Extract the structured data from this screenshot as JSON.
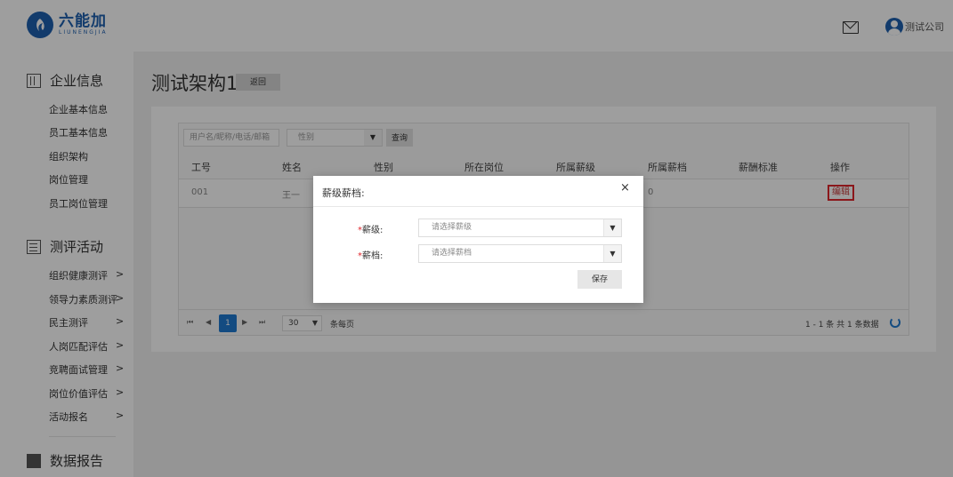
{
  "header": {
    "logo_text": "六能加",
    "logo_subtext": "LIUNENGJIA",
    "company": "测试公司"
  },
  "sidebar": {
    "sections": [
      {
        "title": "企业信息",
        "icon": "building-icon"
      },
      {
        "title": "测评活动",
        "icon": "list-icon"
      },
      {
        "title": "数据报告",
        "icon": "report-icon"
      }
    ],
    "enterprise_items": [
      "企业基本信息",
      "员工基本信息",
      "组织架构",
      "岗位管理",
      "员工岗位管理"
    ],
    "activity_items": [
      "组织健康测评",
      "领导力素质测评",
      "民主测评",
      "人岗匹配评估",
      "竞聘面试管理",
      "岗位价值评估",
      "活动报名"
    ],
    "arrow": ">"
  },
  "main": {
    "title": "测试架构1",
    "back_label": "返回",
    "search_placeholder": "用户名/昵称/电话/邮箱",
    "gender_placeholder": "性别",
    "query_label": "查询",
    "columns": [
      "工号",
      "姓名",
      "性别",
      "所在岗位",
      "所属薪级",
      "所属薪档",
      "薪酬标准",
      "操作"
    ],
    "rows": [
      {
        "id": "001",
        "name": "王一",
        "salary_grade": "0",
        "action": "编辑"
      }
    ],
    "pager": {
      "current_page": "1",
      "page_size": "30",
      "per_page_label": "条每页",
      "summary": "1 - 1 条  共 1 条数据"
    }
  },
  "modal": {
    "title": "薪级薪档:",
    "close": "×",
    "grade_label": "薪级:",
    "grade_placeholder": "请选择薪级",
    "band_label": "薪档:",
    "band_placeholder": "请选择薪档",
    "required_mark": "*",
    "save_label": "保存"
  },
  "colors": {
    "brand": "#1d5fae",
    "pager_active": "#1f7ad0",
    "highlight_red": "#e0262c"
  }
}
